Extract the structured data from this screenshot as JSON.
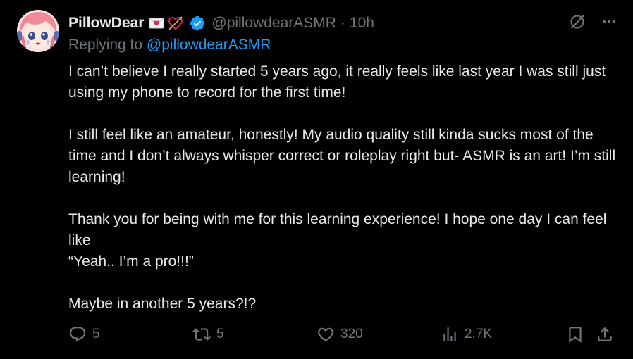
{
  "post": {
    "author": {
      "display_name": "PillowDear",
      "handle": "@pillowdearASMR",
      "separator": "·",
      "time": "10h"
    },
    "replying": {
      "prefix": "Replying to ",
      "mention": "@pillowdearASMR"
    },
    "body": [
      "I can’t believe I really started 5 years ago, it really feels like last year I was still just using my phone to record for the first time!",
      "I still feel like an amateur, honestly! My audio quality still kinda sucks most of the time and I don’t always whisper correct or roleplay right but- ASMR is an art! I’m still learning!",
      "Thank you for being with me for this learning experience! I hope one day I can feel like",
      "“Yeah.. I’m a pro!!!”",
      "Maybe in another 5 years?!?"
    ],
    "stats": {
      "replies": "5",
      "reposts": "5",
      "likes": "320",
      "views": "2.7K"
    }
  },
  "icons": {
    "emoji_1": "love-letter-icon",
    "emoji_2": "heart-arrow-icon",
    "verified": "verified-badge-icon",
    "grok": "grok-icon",
    "more": "more-icon",
    "reply": "reply-icon",
    "repost": "repost-icon",
    "like": "heart-icon",
    "views": "views-chart-icon",
    "bookmark": "bookmark-icon",
    "share": "share-icon"
  },
  "colors": {
    "background": "#000000",
    "text": "#e7e9ea",
    "secondary": "#71767b",
    "accent": "#1d9bf0"
  }
}
